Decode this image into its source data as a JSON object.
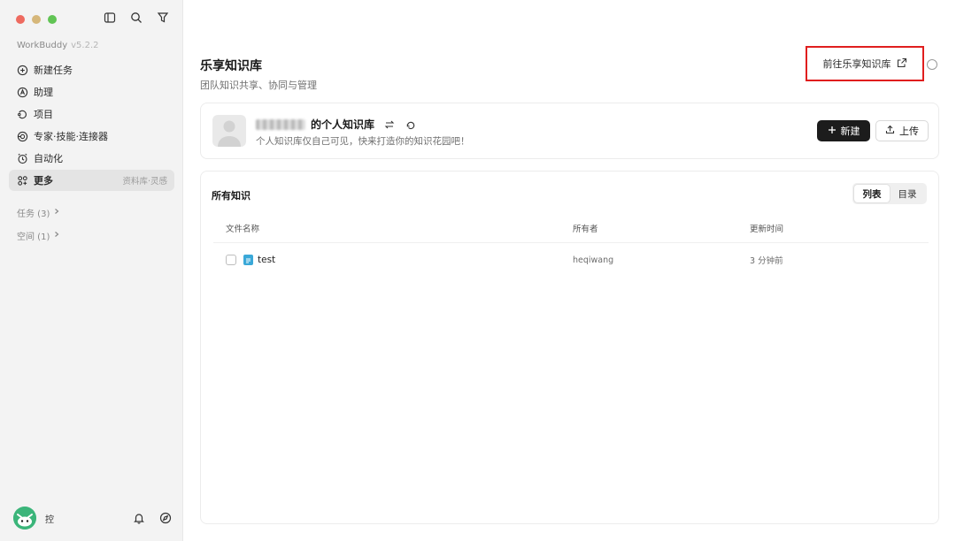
{
  "app": {
    "name": "WorkBuddy",
    "version": "v5.2.2"
  },
  "sidebar": {
    "items": [
      {
        "label": "新建任务",
        "icon": "plus-circle-icon"
      },
      {
        "label": "助理",
        "icon": "assistant-icon"
      },
      {
        "label": "项目",
        "icon": "project-icon"
      },
      {
        "label": "专家·技能·连接器",
        "icon": "expert-icon"
      },
      {
        "label": "自动化",
        "icon": "alarm-icon"
      },
      {
        "label": "更多",
        "icon": "grid-icon",
        "hint": "资料库·灵感"
      }
    ],
    "groups": [
      {
        "label": "任务 (3)"
      },
      {
        "label": "空间 (1)"
      }
    ],
    "user": {
      "name": "控"
    }
  },
  "page": {
    "title": "乐享知识库",
    "subtitle": "团队知识共享、协同与管理",
    "goto_label": "前往乐享知识库"
  },
  "kb_card": {
    "name_suffix": "的个人知识库",
    "description": "个人知识库仅自己可见，快来打造你的知识花园吧！",
    "new_label": "新建",
    "upload_label": "上传"
  },
  "list": {
    "title": "所有知识",
    "views": [
      "列表",
      "目录"
    ],
    "active_view": "列表",
    "columns": [
      "文件名称",
      "所有者",
      "更新时间"
    ],
    "rows": [
      {
        "name": "test",
        "owner": "heqiwang",
        "updated": "3 分钟前"
      }
    ]
  },
  "colors": {
    "accent_red": "#e01e1e",
    "primary_button": "#1c1c1c",
    "avatar_green": "#3bb57a",
    "file_icon_blue": "#3aa8d8"
  }
}
